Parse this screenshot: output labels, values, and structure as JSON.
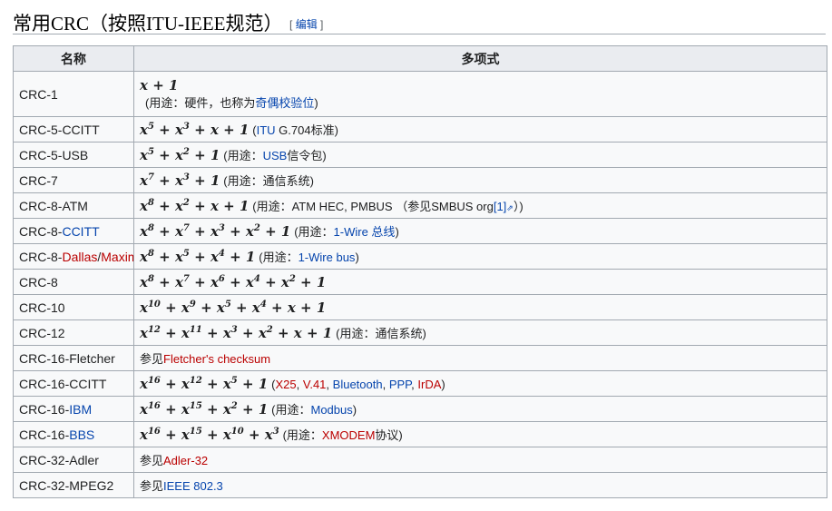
{
  "section": {
    "title": "常用CRC（按照ITU-IEEE规范）",
    "edit_open": "[",
    "edit_label": "编辑",
    "edit_close": "]"
  },
  "table": {
    "headers": [
      "名称",
      "多项式"
    ],
    "rows": [
      {
        "name": [
          {
            "t": "CRC-1"
          }
        ],
        "poly": "x + 1",
        "note": [
          {
            "t": "(用途：硬件，也称为"
          },
          {
            "t": "奇偶校验位",
            "k": "link"
          },
          {
            "t": ")"
          }
        ],
        "tall": true
      },
      {
        "name": [
          {
            "t": "CRC-5-CCITT"
          }
        ],
        "poly": "x^5 + x^3 + x + 1",
        "note": [
          {
            "t": "("
          },
          {
            "t": "ITU",
            "k": "link"
          },
          {
            "t": " G.704标准)"
          }
        ]
      },
      {
        "name": [
          {
            "t": "CRC-5-USB"
          }
        ],
        "poly": "x^5 + x^2 + 1",
        "note": [
          {
            "t": "(用途："
          },
          {
            "t": "USB",
            "k": "link"
          },
          {
            "t": "信令包)"
          }
        ]
      },
      {
        "name": [
          {
            "t": "CRC-7"
          }
        ],
        "poly": "x^7 + x^3 + 1",
        "note": [
          {
            "t": "(用途：通信系统)"
          }
        ]
      },
      {
        "name": [
          {
            "t": "CRC-8-ATM"
          }
        ],
        "poly": "x^8 + x^2 + x + 1",
        "note": [
          {
            "t": "(用途：ATM HEC, PMBUS （参见SMBUS org"
          },
          {
            "t": "[1]",
            "k": "link"
          },
          {
            "t": "⇗",
            "k": "ext"
          },
          {
            "t": "）)"
          }
        ]
      },
      {
        "name": [
          {
            "t": "CRC-8-"
          },
          {
            "t": "CCITT",
            "k": "link"
          }
        ],
        "poly": "x^8 + x^7 + x^3 + x^2 + 1",
        "note": [
          {
            "t": "(用途："
          },
          {
            "t": "1-Wire 总线",
            "k": "link"
          },
          {
            "t": ")"
          }
        ]
      },
      {
        "name": [
          {
            "t": "CRC-8-"
          },
          {
            "t": "Dallas",
            "k": "redlink"
          },
          {
            "t": "/"
          },
          {
            "t": "Maxim",
            "k": "redlink"
          }
        ],
        "poly": "x^8 + x^5 + x^4 + 1",
        "note": [
          {
            "t": "(用途："
          },
          {
            "t": "1-Wire bus",
            "k": "link"
          },
          {
            "t": ")"
          }
        ]
      },
      {
        "name": [
          {
            "t": "CRC-8"
          }
        ],
        "poly": "x^8 + x^7 + x^6 + x^4 + x^2 + 1",
        "note": []
      },
      {
        "name": [
          {
            "t": "CRC-10"
          }
        ],
        "poly": "x^10 + x^9 + x^5 + x^4 + x + 1",
        "note": []
      },
      {
        "name": [
          {
            "t": "CRC-12"
          }
        ],
        "poly": "x^12 + x^11 + x^3 + x^2 + x + 1",
        "note": [
          {
            "t": "(用途：通信系统)"
          }
        ]
      },
      {
        "name": [
          {
            "t": "CRC-16-Fletcher"
          }
        ],
        "poly": "",
        "note": [
          {
            "t": "参见"
          },
          {
            "t": "Fletcher's checksum",
            "k": "redlink"
          }
        ]
      },
      {
        "name": [
          {
            "t": "CRC-16-CCITT"
          }
        ],
        "poly": "x^16 + x^12 + x^5 + 1",
        "note": [
          {
            "t": "("
          },
          {
            "t": "X25",
            "k": "redlink"
          },
          {
            "t": ", "
          },
          {
            "t": "V.41",
            "k": "redlink"
          },
          {
            "t": ", "
          },
          {
            "t": "Bluetooth",
            "k": "link"
          },
          {
            "t": ", "
          },
          {
            "t": "PPP",
            "k": "link"
          },
          {
            "t": ", "
          },
          {
            "t": "IrDA",
            "k": "redlink"
          },
          {
            "t": ")"
          }
        ]
      },
      {
        "name": [
          {
            "t": "CRC-16-"
          },
          {
            "t": "IBM",
            "k": "link"
          }
        ],
        "poly": "x^16 + x^15 + x^2 + 1",
        "note": [
          {
            "t": "(用途："
          },
          {
            "t": "Modbus",
            "k": "link"
          },
          {
            "t": ")"
          }
        ]
      },
      {
        "name": [
          {
            "t": "CRC-16-"
          },
          {
            "t": "BBS",
            "k": "link"
          }
        ],
        "poly": "x^16 + x^15 + x^10 + x^3",
        "note": [
          {
            "t": "(用途："
          },
          {
            "t": "XMODEM",
            "k": "redlink"
          },
          {
            "t": "协议)"
          }
        ]
      },
      {
        "name": [
          {
            "t": "CRC-32-Adler"
          }
        ],
        "poly": "",
        "note": [
          {
            "t": "参见"
          },
          {
            "t": "Adler-32",
            "k": "redlink"
          }
        ]
      },
      {
        "name": [
          {
            "t": "CRC-32-MPEG2"
          }
        ],
        "poly": "",
        "note": [
          {
            "t": "参见"
          },
          {
            "t": "IEEE 802.3",
            "k": "link"
          }
        ]
      }
    ]
  }
}
